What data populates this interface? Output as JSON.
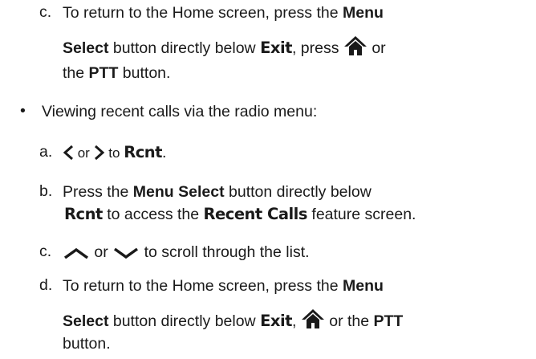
{
  "step_c_top": {
    "marker": "c.",
    "line1_pre": "To return to the Home screen, press the ",
    "line1_bold": "Menu",
    "line2_bold": "Select",
    "line2_mid": " button directly below ",
    "line2_display": "Exit",
    "line2_post1": ", press ",
    "line2_icon": "home-icon",
    "line2_post2": " or",
    "line3_pre": "the ",
    "line3_bold": "PTT",
    "line3_post": " button."
  },
  "bullet": {
    "marker": "•",
    "text": "Viewing recent calls via the radio menu:"
  },
  "step_a": {
    "marker": "a.",
    "left_icon": "left-arrow-icon",
    "or": " or ",
    "right_icon": "right-arrow-icon",
    "to": " to ",
    "display": "Rcnt",
    "post": "."
  },
  "step_b": {
    "marker": "b.",
    "line1_pre": "Press the ",
    "line1_bold": "Menu Select",
    "line1_post": " button directly below",
    "line2_display": "Rcnt",
    "line2_mid": " to access the ",
    "line2_display2": "Recent Calls",
    "line2_post": " feature screen."
  },
  "step_c": {
    "marker": "c.",
    "up_icon": "up-chevron-icon",
    "or": " or ",
    "down_icon": "down-chevron-icon",
    "post": " to scroll through the list."
  },
  "step_d": {
    "marker": "d.",
    "line1_pre": "To return to the Home screen, press the ",
    "line1_bold": "Menu",
    "line2_bold": "Select",
    "line2_mid": " button directly below ",
    "line2_display": "Exit",
    "line2_post1": ", ",
    "line2_icon": "home-icon",
    "line2_post2": " or the ",
    "line2_bold2": "PTT",
    "line3": "button."
  }
}
